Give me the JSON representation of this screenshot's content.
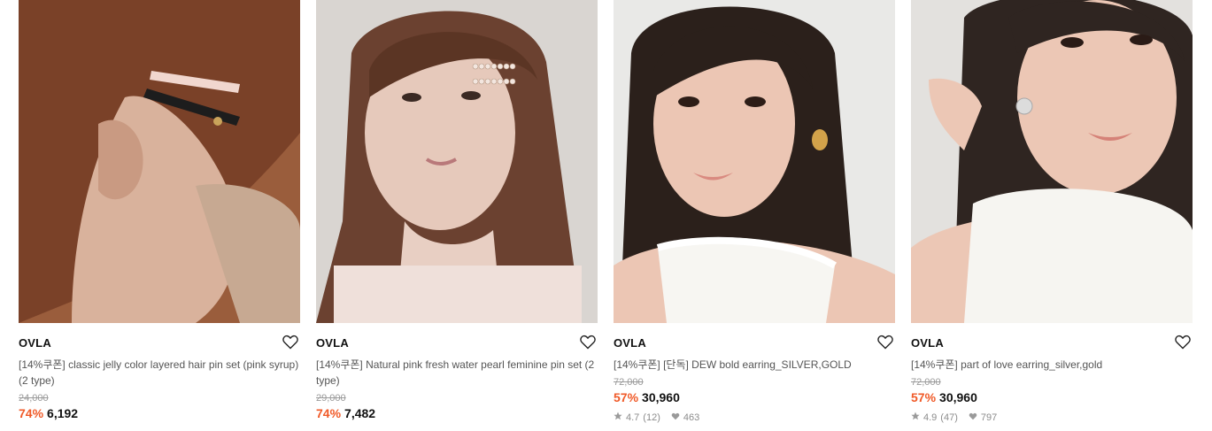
{
  "products": [
    {
      "brand": "OVLA",
      "title": "[14%쿠폰] classic jelly color layered hair pin set (pink syrup) (2 type)",
      "original_price": "24,000",
      "discount": "74%",
      "price": "6,192"
    },
    {
      "brand": "OVLA",
      "title": "[14%쿠폰] Natural pink fresh water pearl feminine pin set (2 type)",
      "original_price": "29,000",
      "discount": "74%",
      "price": "7,482"
    },
    {
      "brand": "OVLA",
      "title": "[14%쿠폰] [단독] DEW bold earring_SILVER,GOLD",
      "original_price": "72,000",
      "discount": "57%",
      "price": "30,960",
      "rating": "4.7",
      "reviews": "(12)",
      "likes": "463"
    },
    {
      "brand": "OVLA",
      "title": "[14%쿠폰] part of love earring_silver,gold",
      "original_price": "72,000",
      "discount": "57%",
      "price": "30,960",
      "rating": "4.9",
      "reviews": "(47)",
      "likes": "797"
    }
  ],
  "colors": {
    "discount": "#f05a28",
    "price": "#111111",
    "muted": "#9a9a9a"
  }
}
